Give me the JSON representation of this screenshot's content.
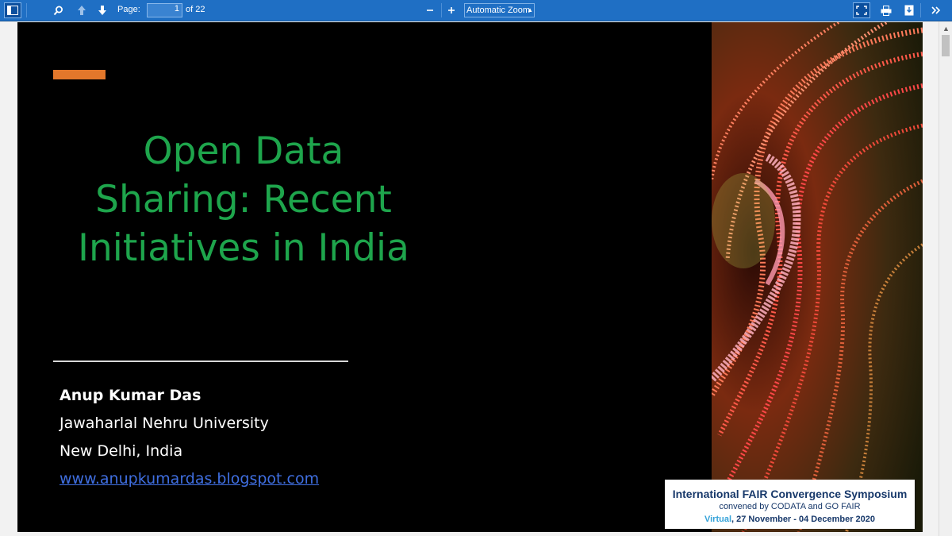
{
  "toolbar": {
    "page_label": "Page:",
    "page_value": "1",
    "page_total": "of 22",
    "zoom_value": "Automatic Zoom",
    "icons": {
      "sidebar": "sidebar-toggle-icon",
      "search": "search-icon",
      "prev": "arrow-up-icon",
      "next": "arrow-down-icon",
      "zoom_out": "minus-icon",
      "zoom_in": "plus-icon",
      "presentation": "fullscreen-icon",
      "print": "printer-icon",
      "download": "download-icon",
      "tools": "double-chevron-right-icon"
    }
  },
  "slide": {
    "title_lines": [
      "Open Data",
      "Sharing: Recent",
      "Initiatives in India"
    ],
    "author": "Anup Kumar Das",
    "affiliation": "Jawaharlal Nehru University",
    "location": "New Delhi, India",
    "website": "www.anupkumardas.blogspot.com",
    "logo": {
      "line1": "International FAIR Convergence Symposium",
      "line2": "convened by CODATA and GO FAIR",
      "line3_highlight": "Virtual",
      "line3_rest": ", 27 November - 04 December 2020"
    },
    "colors": {
      "title": "#1ea54c",
      "accent": "#e2772b",
      "link": "#3f6ee0",
      "toolbar": "#1f6fc4"
    }
  }
}
